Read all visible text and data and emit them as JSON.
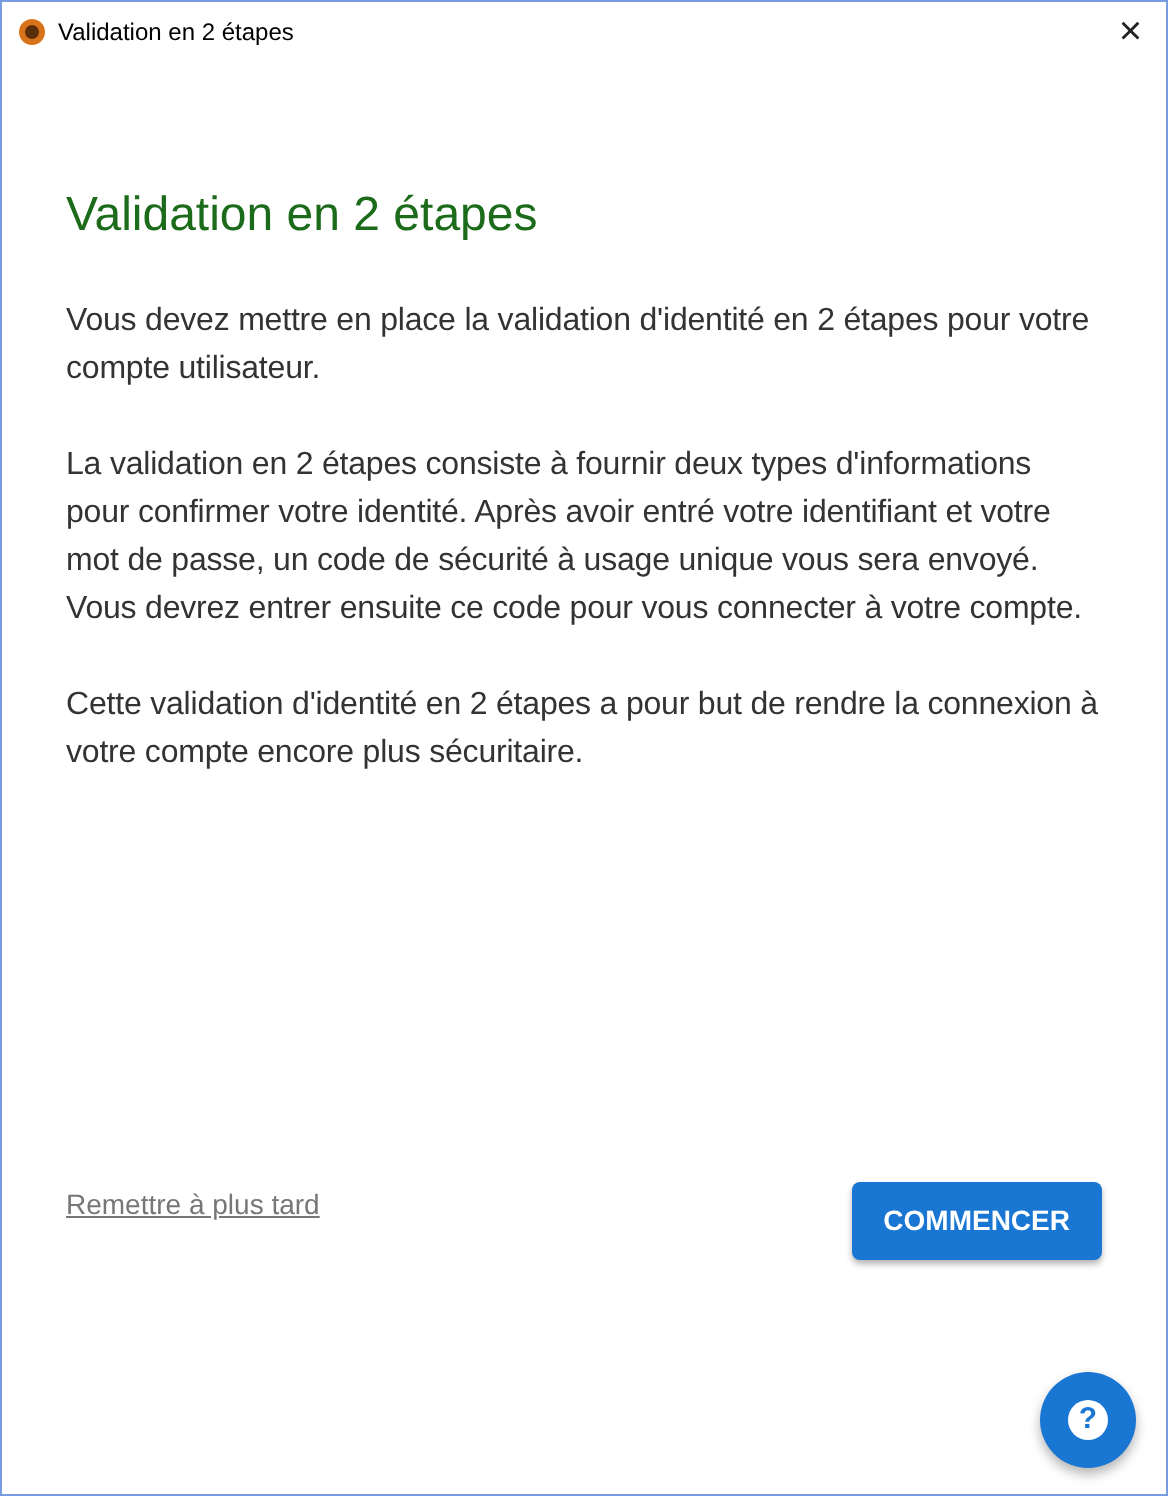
{
  "window": {
    "title": "Validation en 2 étapes",
    "close": "×"
  },
  "heading": "Validation en 2 étapes",
  "paragraphs": [
    "Vous devez mettre en place la validation d'identité en 2 étapes pour votre compte utilisateur.",
    "La validation en 2 étapes consiste à fournir deux types d'informations pour confirmer votre identité. Après avoir entré votre identifiant et votre mot de passe, un code de sécurité à usage unique vous sera envoyé. Vous devrez entrer ensuite ce code pour vous connecter à votre compte.",
    "Cette validation d'identité en 2 étapes a pour but de rendre la connexion à votre compte encore plus sécuritaire."
  ],
  "later_link": "Remettre à plus tard",
  "start_button": "COMMENCER",
  "help_button": "?"
}
